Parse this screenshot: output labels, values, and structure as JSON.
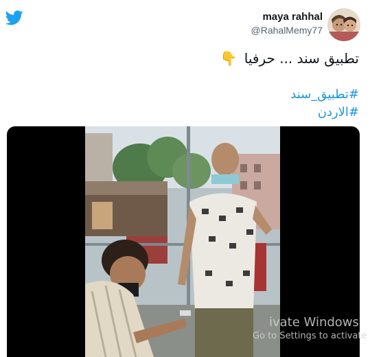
{
  "tweet": {
    "display_name": "maya rahhal",
    "handle": "@RahalMemy77",
    "text": "تطبيق سند ... حرفيا",
    "emoji": "👇",
    "hashtags": [
      "#تطبيق_سند",
      "#الاردن"
    ]
  },
  "icons": {
    "twitter": "twitter-bird-icon",
    "avatar": "avatar"
  },
  "watermark": {
    "title": "ivate Windows",
    "subtitle": "Go to Settings to activate"
  },
  "colors": {
    "twitter_blue": "#1da1f2",
    "hashtag_blue": "#1b95e0",
    "name_text": "#14171a",
    "handle_text": "#536471",
    "media_bg": "#000000"
  }
}
